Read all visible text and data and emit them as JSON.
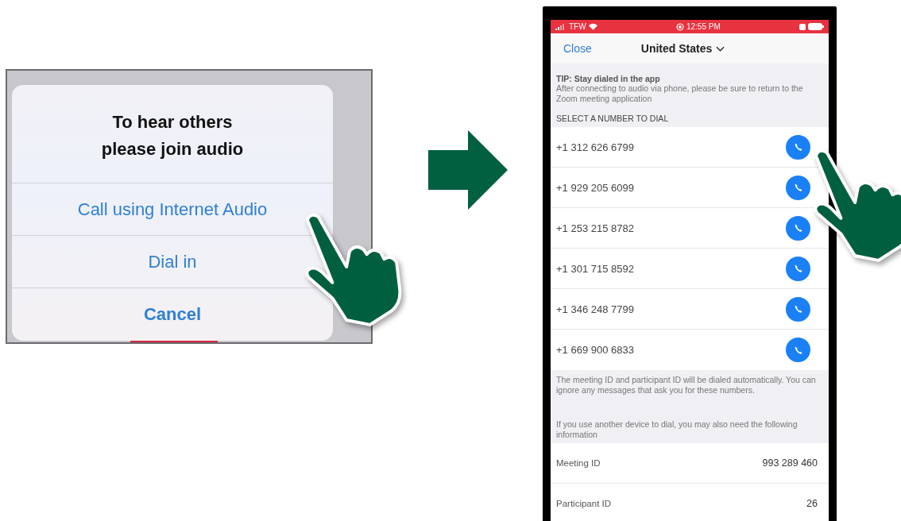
{
  "audio_dialog": {
    "title": "To hear others please join audio",
    "options": [
      {
        "label": "Call using Internet Audio",
        "kind": "default"
      },
      {
        "label": "Dial in",
        "kind": "default"
      },
      {
        "label": "Cancel",
        "kind": "cancel"
      }
    ]
  },
  "phone": {
    "status_bar": {
      "carrier": "TFW",
      "time": "12:55 PM"
    },
    "header": {
      "close": "Close",
      "country": "United States"
    },
    "tip": {
      "title": "TIP: Stay dialed in the app",
      "body": "After connecting to audio via phone, please be sure to return to the Zoom meeting application"
    },
    "section_header": "SELECT A NUMBER TO DIAL",
    "numbers": [
      "+1 312 626 6799",
      "+1 929 205 6099",
      "+1 253 215 8782",
      "+1 301 715 8592",
      "+1 346 248 7799",
      "+1 669 900 6833"
    ],
    "notes": [
      "The meeting ID and participant ID will be dialed automatically. You can ignore any messages that ask you for these numbers.",
      "If you use another device to dial, you may also need the following information"
    ],
    "info": [
      {
        "label": "Meeting ID",
        "value": "993 289 460"
      },
      {
        "label": "Participant ID",
        "value": "26"
      }
    ]
  }
}
